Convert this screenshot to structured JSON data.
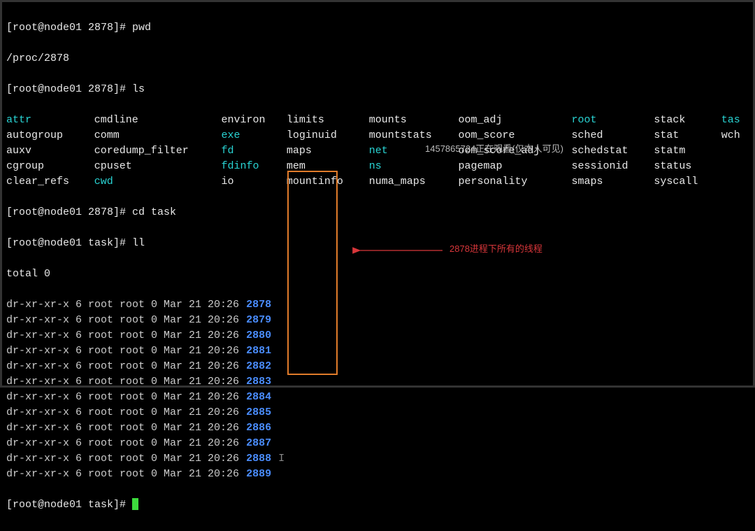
{
  "prompts": {
    "p1": "[root@node01 2878]# ",
    "p2": "[root@node01 task]# "
  },
  "commands": {
    "pwd": "pwd",
    "pwd_out": "/proc/2878",
    "ls": "ls",
    "cdtask": "cd task",
    "ll": "ll",
    "total": "total 0"
  },
  "ls_table": [
    [
      {
        "t": "attr",
        "c": "cyan"
      },
      {
        "t": "cmdline",
        "c": ""
      },
      {
        "t": "environ",
        "c": ""
      },
      {
        "t": "limits",
        "c": ""
      },
      {
        "t": "mounts",
        "c": ""
      },
      {
        "t": "oom_adj",
        "c": ""
      },
      {
        "t": "root",
        "c": "cyan"
      },
      {
        "t": "stack",
        "c": ""
      },
      {
        "t": "tas",
        "c": "cyan"
      }
    ],
    [
      {
        "t": "autogroup",
        "c": ""
      },
      {
        "t": "comm",
        "c": ""
      },
      {
        "t": "exe",
        "c": "cyan"
      },
      {
        "t": "loginuid",
        "c": ""
      },
      {
        "t": "mountstats",
        "c": ""
      },
      {
        "t": "oom_score",
        "c": ""
      },
      {
        "t": "sched",
        "c": ""
      },
      {
        "t": "stat",
        "c": ""
      },
      {
        "t": "wch",
        "c": ""
      }
    ],
    [
      {
        "t": "auxv",
        "c": ""
      },
      {
        "t": "coredump_filter",
        "c": ""
      },
      {
        "t": "fd",
        "c": "cyan"
      },
      {
        "t": "maps",
        "c": ""
      },
      {
        "t": "net",
        "c": "cyan"
      },
      {
        "t": "oom_score_adj",
        "c": ""
      },
      {
        "t": "schedstat",
        "c": ""
      },
      {
        "t": "statm",
        "c": ""
      },
      {
        "t": "",
        "c": ""
      }
    ],
    [
      {
        "t": "cgroup",
        "c": ""
      },
      {
        "t": "cpuset",
        "c": ""
      },
      {
        "t": "fdinfo",
        "c": "cyan"
      },
      {
        "t": "mem",
        "c": ""
      },
      {
        "t": "ns",
        "c": "cyan"
      },
      {
        "t": "pagemap",
        "c": ""
      },
      {
        "t": "sessionid",
        "c": ""
      },
      {
        "t": "status",
        "c": ""
      },
      {
        "t": "",
        "c": ""
      }
    ],
    [
      {
        "t": "clear_refs",
        "c": ""
      },
      {
        "t": "cwd",
        "c": "cyan"
      },
      {
        "t": "io",
        "c": ""
      },
      {
        "t": "mountinfo",
        "c": ""
      },
      {
        "t": "numa_maps",
        "c": ""
      },
      {
        "t": "personality",
        "c": ""
      },
      {
        "t": "smaps",
        "c": ""
      },
      {
        "t": "syscall",
        "c": ""
      },
      {
        "t": "",
        "c": ""
      }
    ]
  ],
  "ll_rows": [
    {
      "prefix": "dr-xr-xr-x 6 root root 0 Mar 21 20:26",
      "pid": "2878"
    },
    {
      "prefix": "dr-xr-xr-x 6 root root 0 Mar 21 20:26",
      "pid": "2879"
    },
    {
      "prefix": "dr-xr-xr-x 6 root root 0 Mar 21 20:26",
      "pid": "2880"
    },
    {
      "prefix": "dr-xr-xr-x 6 root root 0 Mar 21 20:26",
      "pid": "2881"
    },
    {
      "prefix": "dr-xr-xr-x 6 root root 0 Mar 21 20:26",
      "pid": "2882"
    },
    {
      "prefix": "dr-xr-xr-x 6 root root 0 Mar 21 20:26",
      "pid": "2883"
    },
    {
      "prefix": "dr-xr-xr-x 6 root root 0 Mar 21 20:26",
      "pid": "2884"
    },
    {
      "prefix": "dr-xr-xr-x 6 root root 0 Mar 21 20:26",
      "pid": "2885"
    },
    {
      "prefix": "dr-xr-xr-x 6 root root 0 Mar 21 20:26",
      "pid": "2886"
    },
    {
      "prefix": "dr-xr-xr-x 6 root root 0 Mar 21 20:26",
      "pid": "2887"
    },
    {
      "prefix": "dr-xr-xr-x 6 root root 0 Mar 21 20:26",
      "pid": "2888"
    },
    {
      "prefix": "dr-xr-xr-x 6 root root 0 Mar 21 20:26",
      "pid": "2889"
    }
  ],
  "cursor_row_suffix": "I",
  "watermark": "1457865724正在观看(仅本人可见)",
  "annotation": "2878进程下所有的线程"
}
